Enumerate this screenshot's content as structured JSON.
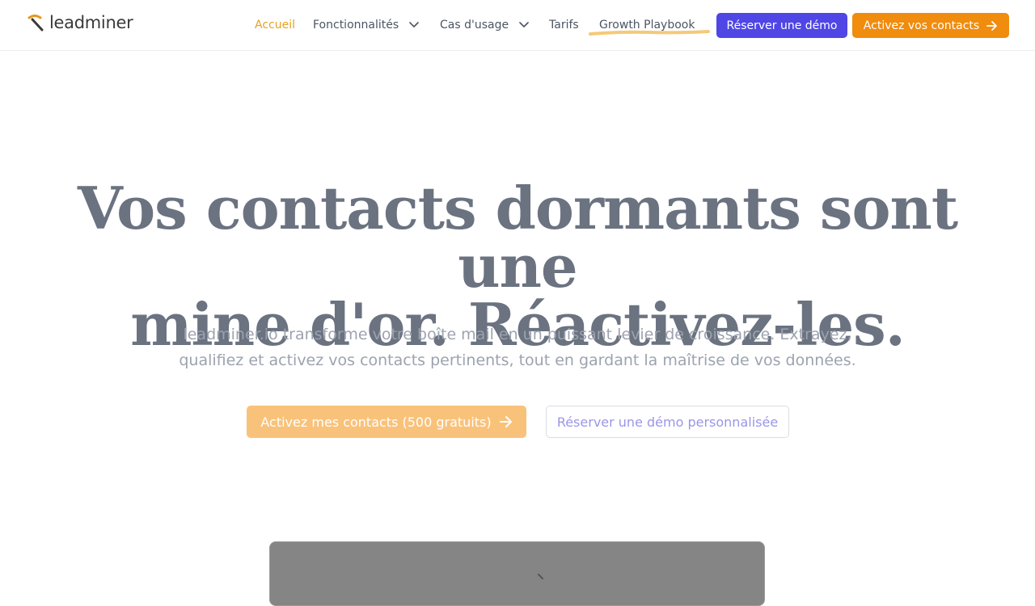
{
  "header": {
    "logo_text": "leadminer",
    "nav": {
      "home": "Accueil",
      "features": "Fonctionnalités",
      "use_cases": "Cas d'usage",
      "pricing": "Tarifs",
      "playbook": "Growth Playbook"
    },
    "demo_button": "Réserver une démo",
    "activate_button": "Activez vos contacts"
  },
  "hero": {
    "title_line1": "Vos contacts dormants sont une",
    "title_line2": "mine d'or. Réactivez-les.",
    "subtitle_line1": "leadminer.io transforme votre boîte mail en un puissant levier de croissance. Extrayez,",
    "subtitle_line2": "qualifiez et activez vos contacts pertinents, tout en gardant la maîtrise de vos données.",
    "cta_primary": "Activez mes contacts (500 gratuits)",
    "cta_secondary": "Réserver une démo personnalisée"
  },
  "icons": {
    "logo": "pickaxe-icon",
    "dropdown": "chevron-down-icon",
    "arrow": "arrow-right-icon"
  },
  "colors": {
    "accent_orange": "#f08c0e",
    "accent_indigo": "#4f46e5",
    "active_nav": "#e5a21e",
    "title_gray": "#6b7280"
  }
}
